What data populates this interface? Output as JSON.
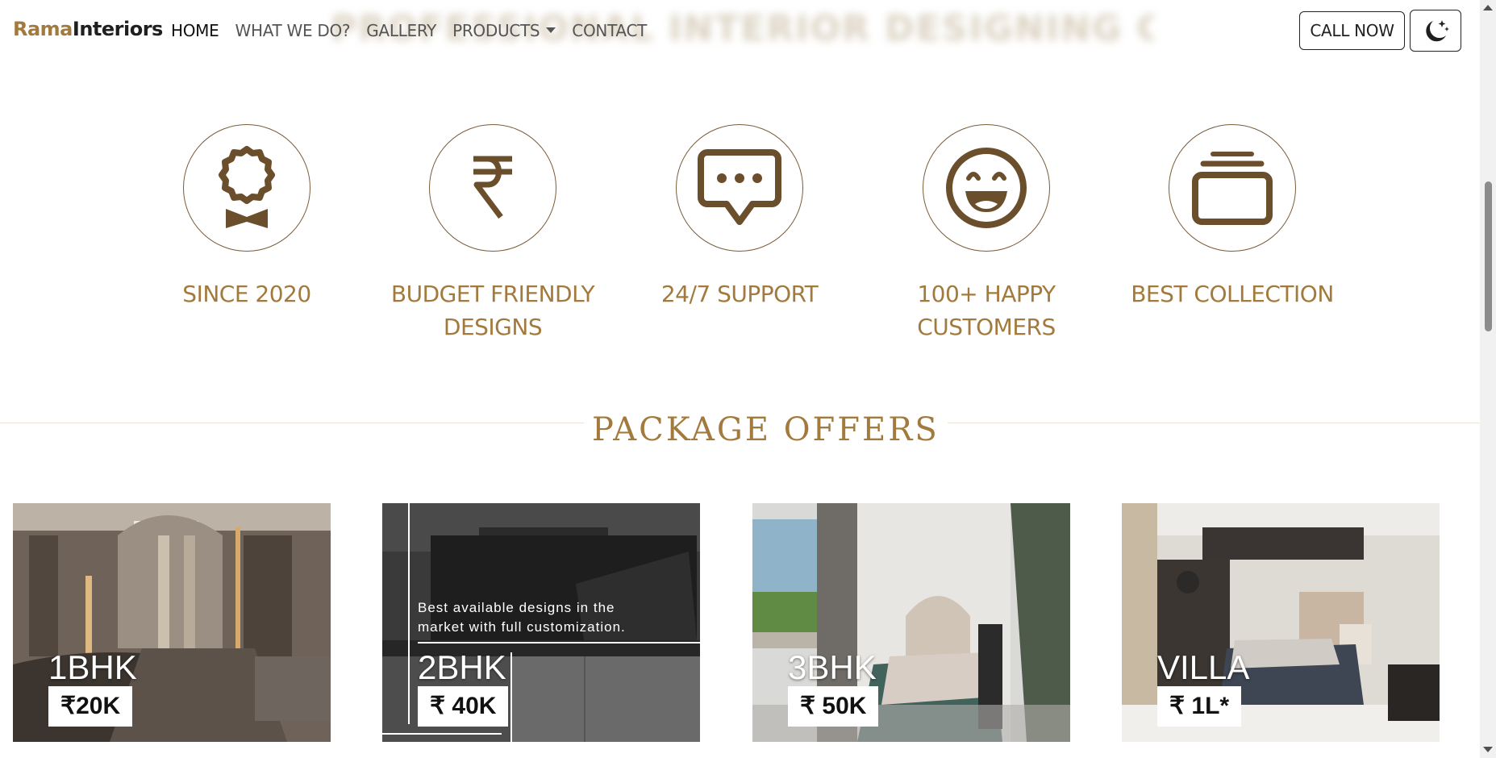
{
  "navbar": {
    "brand_part1": "Rama",
    "brand_part2": "Interiors",
    "background_title": "PROFESSIONAL INTERIOR DESIGNING COMPANY",
    "links": [
      {
        "label": "HOME",
        "active": true
      },
      {
        "label": "WHAT WE DO?",
        "active": false
      },
      {
        "label": "GALLERY",
        "active": false
      },
      {
        "label": "PRODUCTS",
        "active": false,
        "dropdown": true
      },
      {
        "label": "CONTACT",
        "active": false
      }
    ],
    "call_button": "CALL NOW",
    "theme_toggle_icon": "moon-stars-icon"
  },
  "features": [
    {
      "icon": "award-icon",
      "label": "SINCE 2020"
    },
    {
      "icon": "rupee-icon",
      "label": "BUDGET FRIENDLY DESIGNS"
    },
    {
      "icon": "chat-dots-icon",
      "label": "24/7 SUPPORT"
    },
    {
      "icon": "happy-face-icon",
      "label": "100+ HAPPY CUSTOMERS"
    },
    {
      "icon": "collection-icon",
      "label": "BEST COLLECTION"
    }
  ],
  "packages": {
    "title": "PACKAGE OFFERS",
    "cards": [
      {
        "name": "1BHK",
        "price": "₹20K"
      },
      {
        "name": "2BHK",
        "price": "₹ 40K",
        "description": "Best available designs in the market with full customization."
      },
      {
        "name": "3BHK",
        "price": "₹ 50K"
      },
      {
        "name": "VILLA",
        "price": "₹ 1L*"
      }
    ]
  },
  "colors": {
    "accent": "#a37a3d",
    "icon": "#6b4f2c",
    "circle_border": "#7a5c3a"
  }
}
